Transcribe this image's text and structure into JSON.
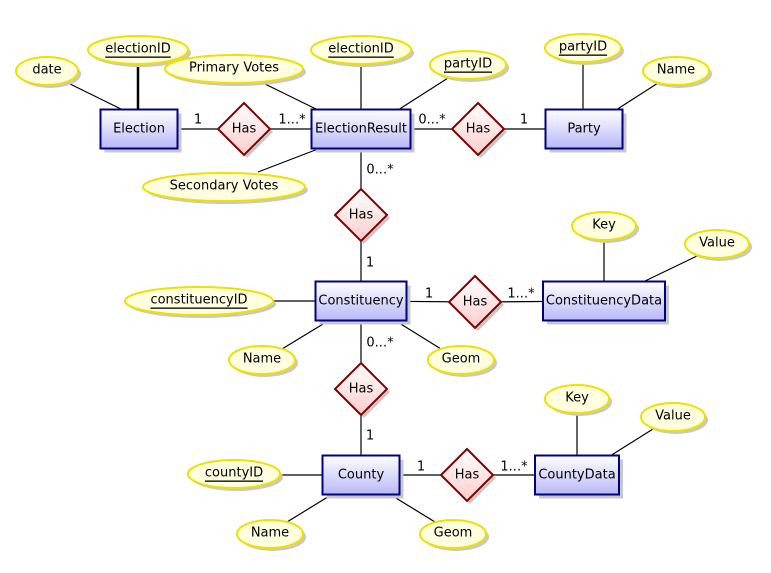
{
  "colors": {
    "entity_border": "#000080",
    "entity_fill_top": "#ffffff",
    "entity_fill_bottom": "#b8b8f8",
    "attribute_border": "#f0e000",
    "attribute_fill": "#ffffe0",
    "relationship_border": "#800000",
    "relationship_fill_top": "#ffffff",
    "relationship_fill_bottom": "#ffcccc"
  },
  "entities": [
    {
      "id": "election",
      "label": "Election"
    },
    {
      "id": "electionresult",
      "label": "ElectionResult"
    },
    {
      "id": "party",
      "label": "Party"
    },
    {
      "id": "constituency",
      "label": "Constituency"
    },
    {
      "id": "constituencydata",
      "label": "ConstituencyData"
    },
    {
      "id": "county",
      "label": "County"
    },
    {
      "id": "countydata",
      "label": "CountyData"
    }
  ],
  "attributes": [
    {
      "id": "a1",
      "label": "date",
      "of": "election",
      "key": false
    },
    {
      "id": "a2",
      "label": "electionID",
      "of": "election",
      "key": true
    },
    {
      "id": "a3",
      "label": "Primary Votes",
      "of": "electionresult",
      "key": false
    },
    {
      "id": "a4",
      "label": "electionID",
      "of": "electionresult",
      "key": true
    },
    {
      "id": "a5",
      "label": "partyID",
      "of": "electionresult",
      "key": true
    },
    {
      "id": "a6",
      "label": "partyID",
      "of": "party",
      "key": true
    },
    {
      "id": "a7",
      "label": "Name",
      "of": "party",
      "key": false
    },
    {
      "id": "a8",
      "label": "Secondary Votes",
      "of": "electionresult",
      "key": false
    },
    {
      "id": "a9",
      "label": "Key",
      "of": "constituencydata",
      "key": false
    },
    {
      "id": "a10",
      "label": "Value",
      "of": "constituencydata",
      "key": false
    },
    {
      "id": "a11",
      "label": "constituencyID",
      "of": "constituency",
      "key": true
    },
    {
      "id": "a12",
      "label": "Name",
      "of": "constituency",
      "key": false
    },
    {
      "id": "a13",
      "label": "Geom",
      "of": "constituency",
      "key": false
    },
    {
      "id": "a14",
      "label": "Key",
      "of": "countydata",
      "key": false
    },
    {
      "id": "a15",
      "label": "Value",
      "of": "countydata",
      "key": false
    },
    {
      "id": "a16",
      "label": "countyID",
      "of": "county",
      "key": true
    },
    {
      "id": "a17",
      "label": "Name",
      "of": "county",
      "key": false
    },
    {
      "id": "a18",
      "label": "Geom",
      "of": "county",
      "key": false
    }
  ],
  "relationships": [
    {
      "id": "r1",
      "label": "Has",
      "from": "election",
      "to": "electionresult",
      "from_card": "1",
      "to_card": "1...*"
    },
    {
      "id": "r2",
      "label": "Has",
      "from": "electionresult",
      "to": "party",
      "from_card": "0...*",
      "to_card": "1"
    },
    {
      "id": "r3",
      "label": "Has",
      "from": "electionresult",
      "to": "constituency",
      "from_card": "0...*",
      "to_card": "1"
    },
    {
      "id": "r4",
      "label": "Has",
      "from": "constituency",
      "to": "constituencydata",
      "from_card": "1",
      "to_card": "1...*"
    },
    {
      "id": "r5",
      "label": "Has",
      "from": "constituency",
      "to": "county",
      "from_card": "0...*",
      "to_card": "1"
    },
    {
      "id": "r6",
      "label": "Has",
      "from": "county",
      "to": "countydata",
      "from_card": "1",
      "to_card": "1...*"
    }
  ]
}
